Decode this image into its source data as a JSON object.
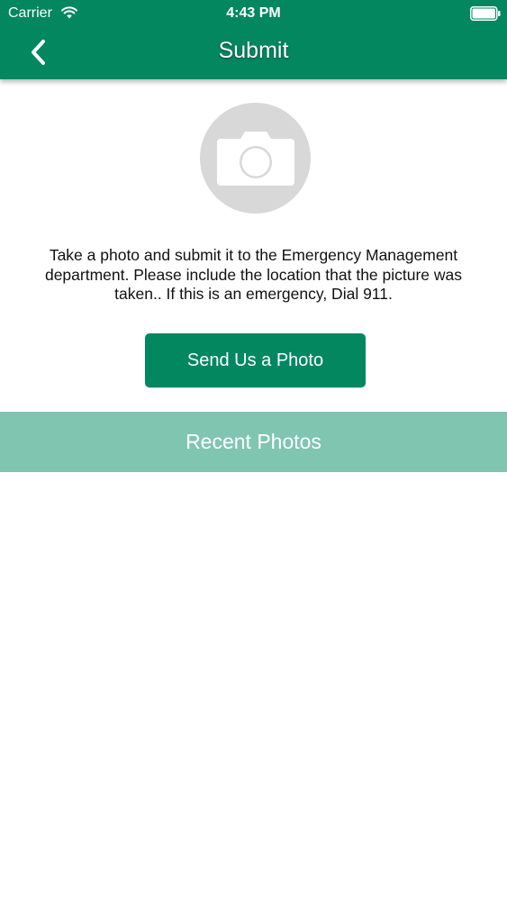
{
  "status_bar": {
    "carrier": "Carrier",
    "time": "4:43 PM"
  },
  "nav": {
    "title": "Submit",
    "back_icon": "chevron-left-icon"
  },
  "camera": {
    "icon": "camera-icon"
  },
  "description": "Take a photo and submit it to the Emergency Management department.  Please include the location that the picture was taken..  If this is an emergency, Dial 911.",
  "send_button": {
    "label": "Send Us a Photo"
  },
  "recent_photos": {
    "title": "Recent Photos"
  },
  "colors": {
    "primary": "#02875f",
    "section_header": "#80c5b0",
    "placeholder_gray": "#d8d8d8"
  }
}
